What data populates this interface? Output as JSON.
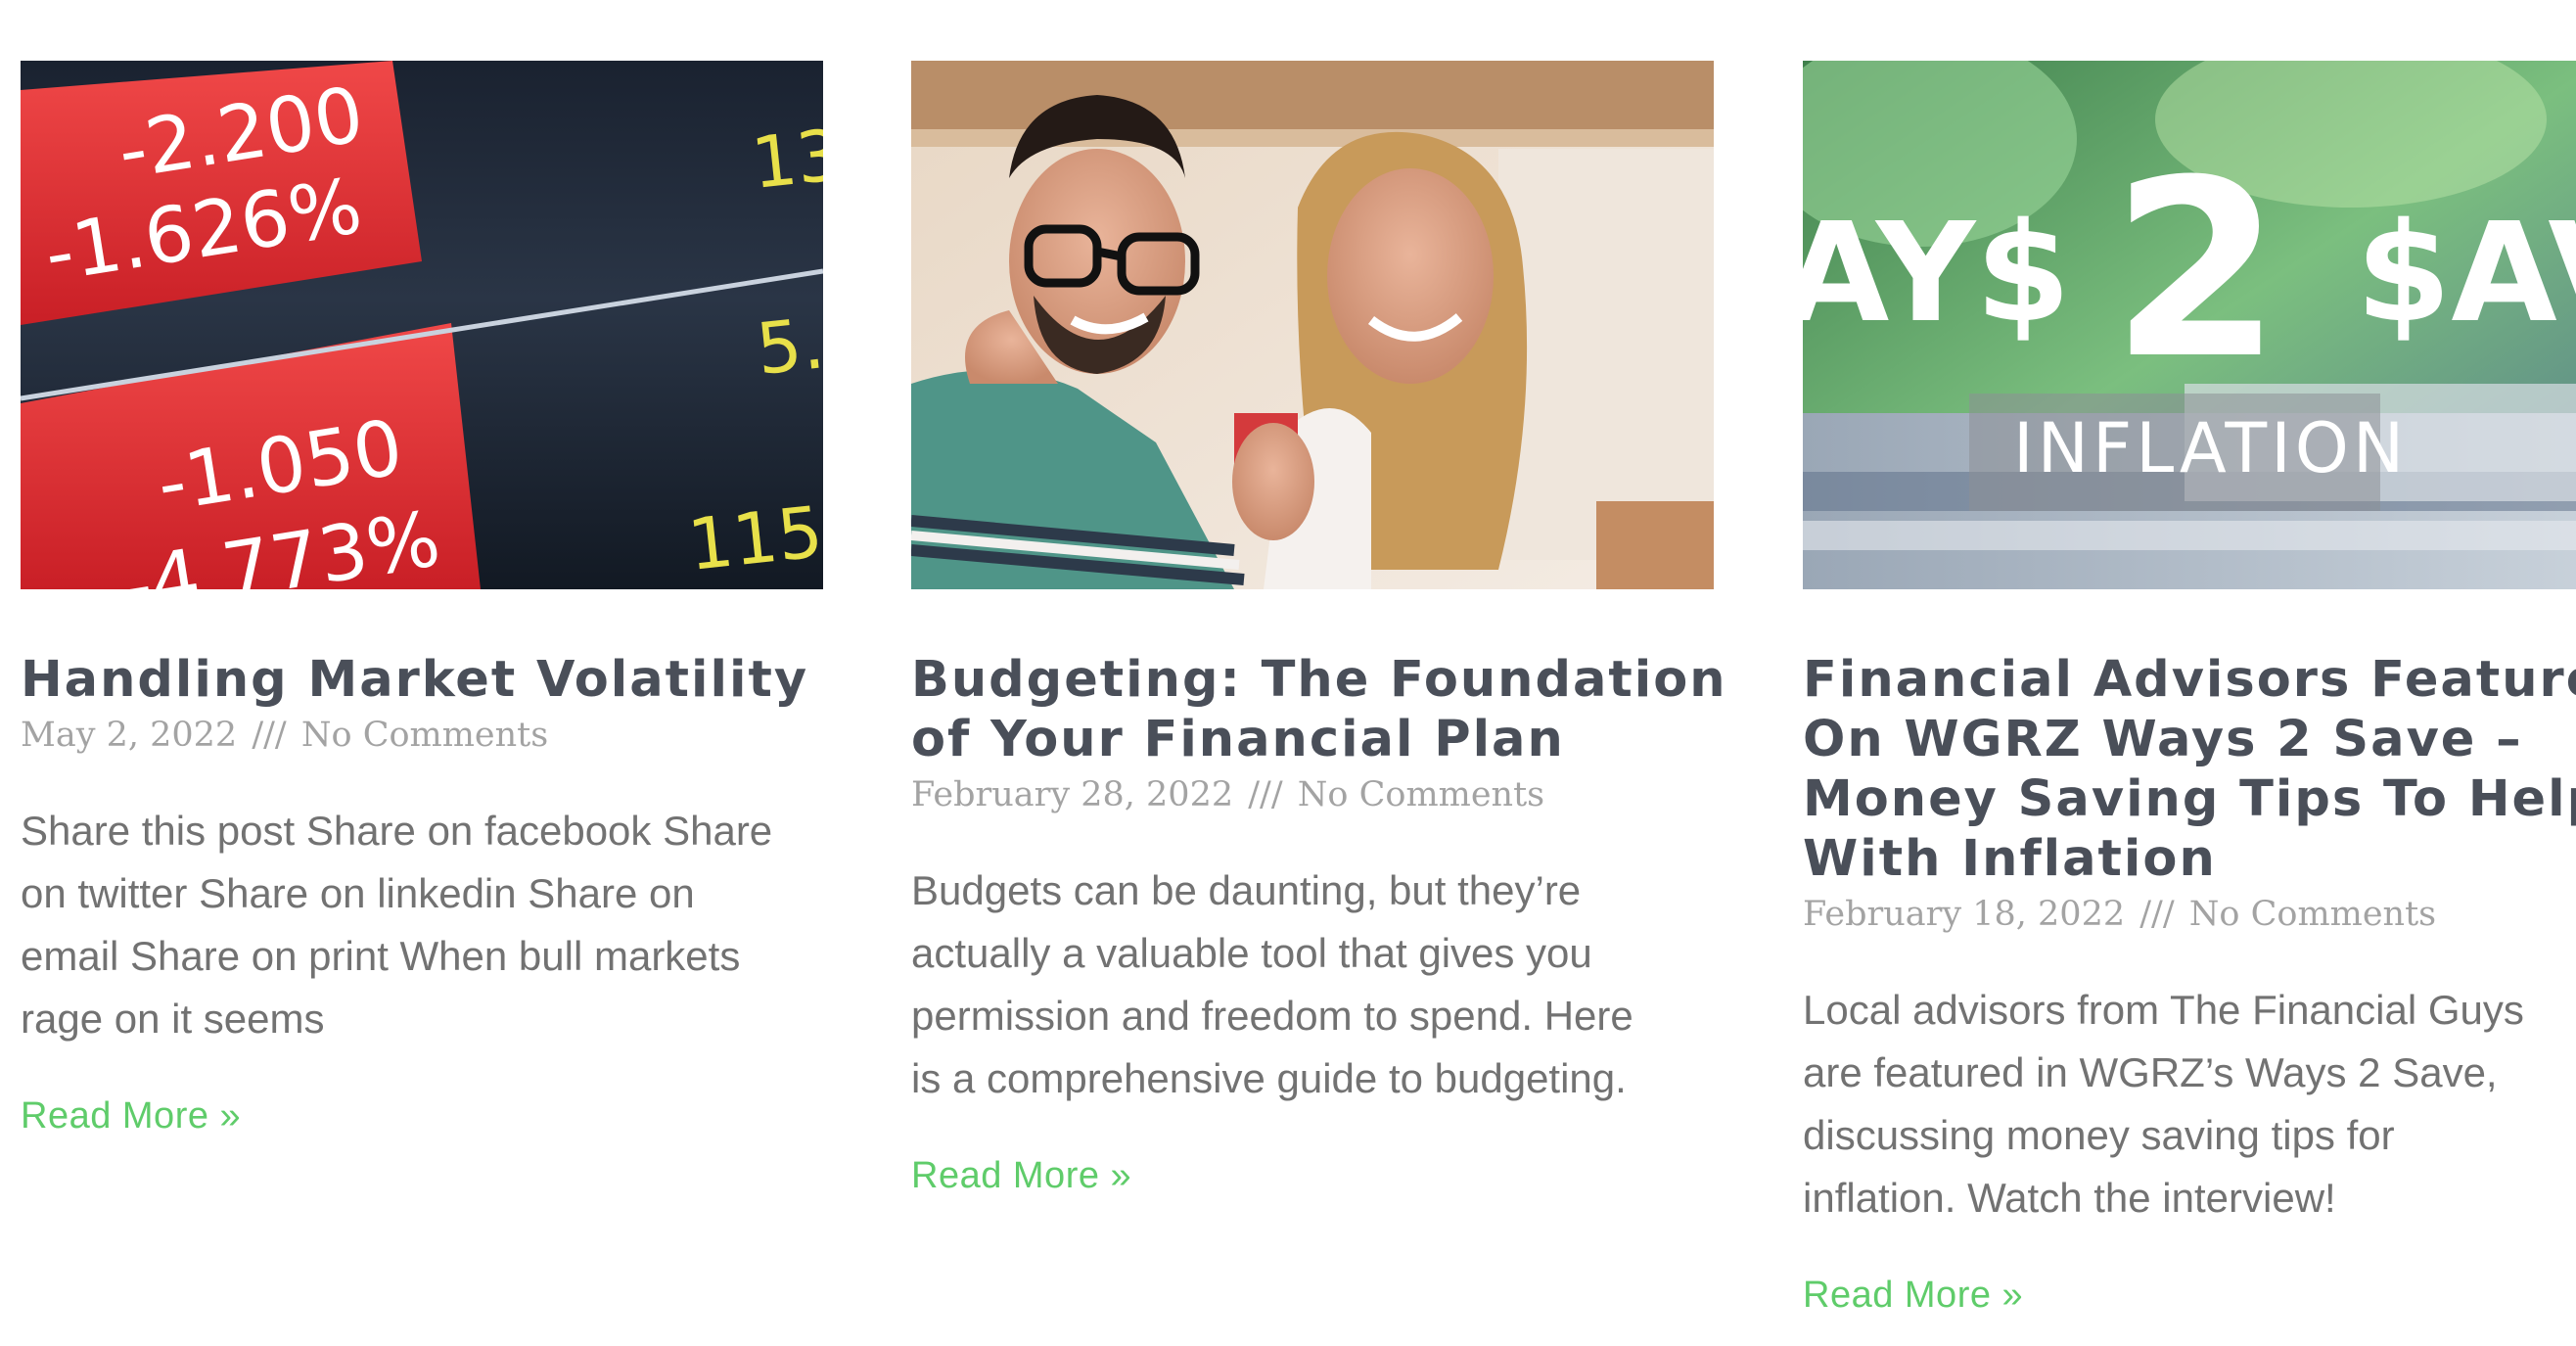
{
  "posts": [
    {
      "image_icon": "stock-ticker-board",
      "image_text": {
        "top_value": "-2.200",
        "top_percent": "-1.626%",
        "bottom_value": "-1.050",
        "bottom_percent": "-4.773%",
        "right_1": "13",
        "right_2": "5.",
        "right_3": "115"
      },
      "title_lines": [
        "Handling Market Volatility"
      ],
      "date": "May 2, 2022",
      "separator": "///",
      "comments": "No Comments",
      "excerpt_lines": [
        "Share this post Share on facebook Share",
        "on twitter Share on linkedin Share on",
        "email Share on print When bull markets",
        "rage on it seems"
      ],
      "read_more": "Read More »"
    },
    {
      "image_icon": "smiling-couple-photo",
      "title_lines": [
        "Budgeting: The Foundation",
        "of Your Financial Plan"
      ],
      "date": "February 28, 2022",
      "separator": "///",
      "comments": "No Comments",
      "excerpt_lines": [
        "Budgets can be daunting, but they’re",
        "actually a valuable tool that gives you",
        "permission and freedom to spend. Here",
        "is a comprehensive guide to budgeting."
      ],
      "read_more": "Read More »"
    },
    {
      "image_icon": "ways-2-save-logo",
      "image_text": {
        "logo_left": "AY$",
        "logo_number": "2",
        "logo_right": "$AV",
        "logo_sub": "INFLATION"
      },
      "title_lines": [
        "Financial Advisors Featured",
        "On WGRZ Ways 2 Save –",
        "Money Saving Tips To Help",
        "With Inflation"
      ],
      "date": "February 18, 2022",
      "separator": "///",
      "comments": "No Comments",
      "excerpt_lines": [
        "Local advisors from The Financial Guys",
        "are featured in WGRZ’s Ways 2 Save,",
        "discussing money saving tips for",
        "inflation. Watch the interview!"
      ],
      "read_more": "Read More »"
    }
  ],
  "colors": {
    "title": "#4a4f59",
    "meta": "#a3a3a3",
    "excerpt": "#727272",
    "read_more": "#5fcc6a"
  }
}
